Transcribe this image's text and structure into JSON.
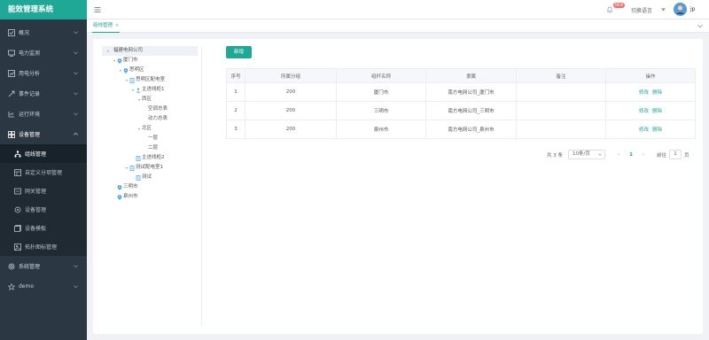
{
  "app": {
    "title": "能效管理系统"
  },
  "sidebar": {
    "items": [
      {
        "label": "概况",
        "icon": "overview-icon"
      },
      {
        "label": "电力监测",
        "icon": "monitor-icon"
      },
      {
        "label": "用电分析",
        "icon": "analysis-icon"
      },
      {
        "label": "事件记录",
        "icon": "event-icon"
      },
      {
        "label": "运行环境",
        "icon": "environment-icon"
      },
      {
        "label": "设备管理",
        "icon": "device-icon"
      }
    ],
    "sub_items": [
      {
        "label": "组线管理",
        "icon": "network-icon"
      },
      {
        "label": "自定义分项管理",
        "icon": "custom-item-icon"
      },
      {
        "label": "网关管理",
        "icon": "gateway-icon"
      },
      {
        "label": "设备管理",
        "icon": "device-manage-icon"
      },
      {
        "label": "设备模板",
        "icon": "template-icon"
      },
      {
        "label": "拓扑图标管理",
        "icon": "topology-icon"
      }
    ],
    "bottom_items": [
      {
        "label": "系统管理",
        "icon": "system-icon"
      },
      {
        "label": "demo",
        "icon": "star-icon"
      }
    ]
  },
  "header": {
    "new_badge": "NEW",
    "language": "切换语言",
    "user": "jp"
  },
  "tags": {
    "active": "组线管理",
    "close": "×"
  },
  "tree": [
    {
      "label": "福建电网公司",
      "level": 0,
      "type": "root",
      "expanded": true
    },
    {
      "label": "厦门市",
      "level": 1,
      "type": "location",
      "expanded": true
    },
    {
      "label": "思明区",
      "level": 2,
      "type": "location",
      "expanded": true
    },
    {
      "label": "思明区配电室",
      "level": 3,
      "type": "room",
      "expanded": true
    },
    {
      "label": "主进线柜1",
      "level": 4,
      "type": "cabinet",
      "expanded": true
    },
    {
      "label": "西区",
      "level": 5,
      "type": "text",
      "expanded": true
    },
    {
      "label": "空调总表",
      "level": 6,
      "type": "text"
    },
    {
      "label": "动力总表",
      "level": 6,
      "type": "text"
    },
    {
      "label": "北区",
      "level": 5,
      "type": "text",
      "expanded": true
    },
    {
      "label": "一层",
      "level": 6,
      "type": "text"
    },
    {
      "label": "二层",
      "level": 6,
      "type": "text"
    },
    {
      "label": "主进线柜2",
      "level": 4,
      "type": "room"
    },
    {
      "label": "测试配电室1",
      "level": 3,
      "type": "room",
      "expanded": true
    },
    {
      "label": "测试",
      "level": 4,
      "type": "room"
    },
    {
      "label": "三明市",
      "level": 1,
      "type": "location"
    },
    {
      "label": "泉州市",
      "level": 1,
      "type": "location"
    }
  ],
  "main": {
    "add_button": "新增",
    "table": {
      "headers": [
        "序号",
        "所属分组",
        "组杆名称",
        "隶属",
        "备注",
        "操作"
      ],
      "rows": [
        {
          "no": "1",
          "group": "200",
          "name": "厦门市",
          "belong": "南方电网公司_厦门市",
          "remark": "",
          "edit": "修改",
          "del": "删除"
        },
        {
          "no": "2",
          "group": "200",
          "name": "三明市",
          "belong": "南方电网公司_三明市",
          "remark": "",
          "edit": "修改",
          "del": "删除"
        },
        {
          "no": "3",
          "group": "200",
          "name": "泉州市",
          "belong": "南方电网公司_泉州市",
          "remark": "",
          "edit": "修改",
          "del": "删除"
        }
      ]
    },
    "pagination": {
      "total": "共 3 条",
      "page_size": "10条/页",
      "prev": "‹",
      "page": "1",
      "next": "›",
      "goto": "前往",
      "goto_value": "1",
      "page_unit": "页"
    }
  },
  "colors": {
    "accent": "#1fa896",
    "sidebar": "#2b3843",
    "danger": "#f56c6c"
  }
}
